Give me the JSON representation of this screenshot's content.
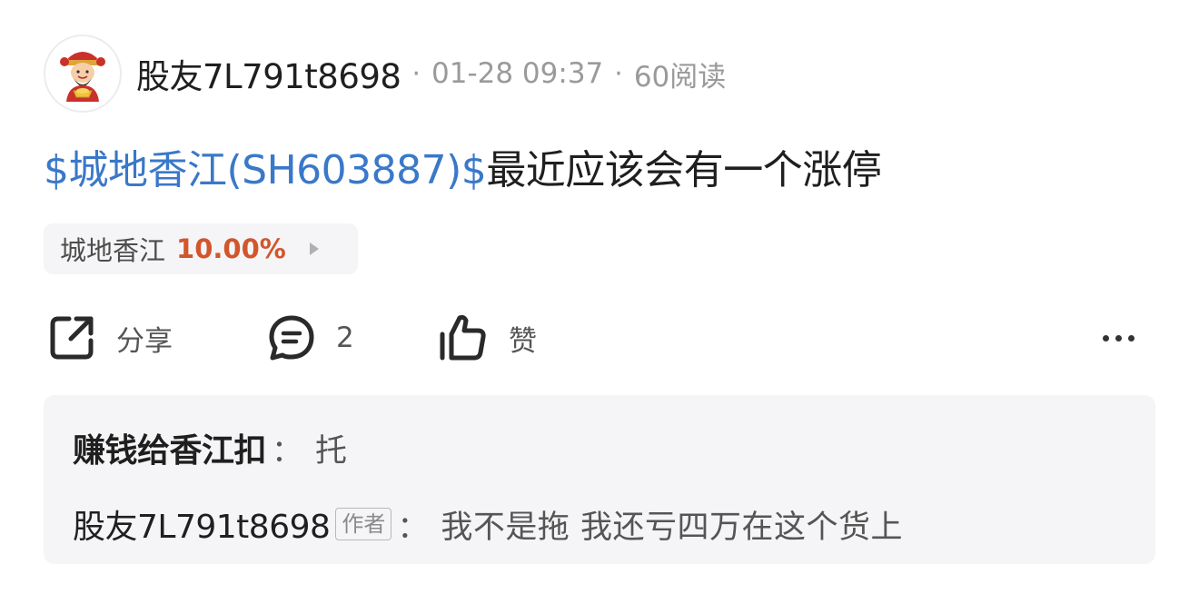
{
  "post": {
    "author": {
      "name": "股友7L791t8698",
      "avatar_icon": "fortune-god-avatar-icon"
    },
    "time": "01-28 09:37",
    "reads": "60阅读",
    "separator": "·",
    "content": {
      "stock_link": "$城地香江(SH603887)$",
      "text": "最近应该会有一个涨停"
    },
    "stock_chip": {
      "name": "城地香江",
      "change": "10.00%",
      "change_color": "#d2562c",
      "arrow_icon": "triangle-right-icon"
    },
    "actions": {
      "share_label": "分享",
      "comment_count": "2",
      "like_label": "赞",
      "more_icon": "more-dots-icon"
    },
    "comments": [
      {
        "author": "赚钱给香江扣",
        "colon": "：",
        "text": "托"
      },
      {
        "author": "股友7L791t8698",
        "badge": "作者",
        "colon": "：",
        "text": "我不是拖 我还亏四万在这个货上"
      }
    ],
    "colors": {
      "link": "#3a78c9",
      "muted": "#9a9a9a",
      "panel_bg": "#f5f5f7"
    }
  }
}
